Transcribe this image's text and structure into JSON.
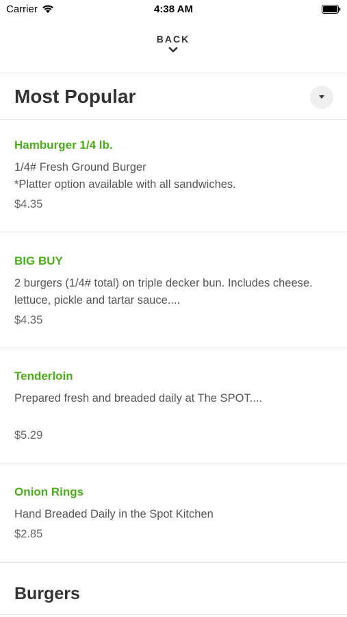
{
  "status_bar": {
    "carrier": "Carrier",
    "time": "4:38 AM"
  },
  "nav": {
    "back_label": "BACK"
  },
  "sections": [
    {
      "title": "Most Popular",
      "items": [
        {
          "name": "Hamburger 1/4 lb.",
          "description": "1/4# Fresh Ground Burger\n*Platter option available with all sandwiches.",
          "price": "$4.35"
        },
        {
          "name": "BIG BUY",
          "description": "2 burgers (1/4# total) on triple decker bun.  Includes cheese. lettuce, pickle and tartar sauce....",
          "price": "$4.35"
        },
        {
          "name": "Tenderloin",
          "description": "Prepared fresh and breaded daily at The SPOT....",
          "price": "$5.29"
        },
        {
          "name": "Onion Rings",
          "description": "Hand Breaded Daily in the Spot Kitchen",
          "price": "$2.85"
        }
      ]
    },
    {
      "title": "Burgers"
    }
  ],
  "icons": {
    "wifi": "wifi-icon",
    "battery": "battery-icon",
    "back": "chevron-down-icon",
    "dropdown": "caret-down-icon"
  },
  "colors": {
    "item_name": "#4caf1a",
    "divider": "#e6e6e6"
  }
}
